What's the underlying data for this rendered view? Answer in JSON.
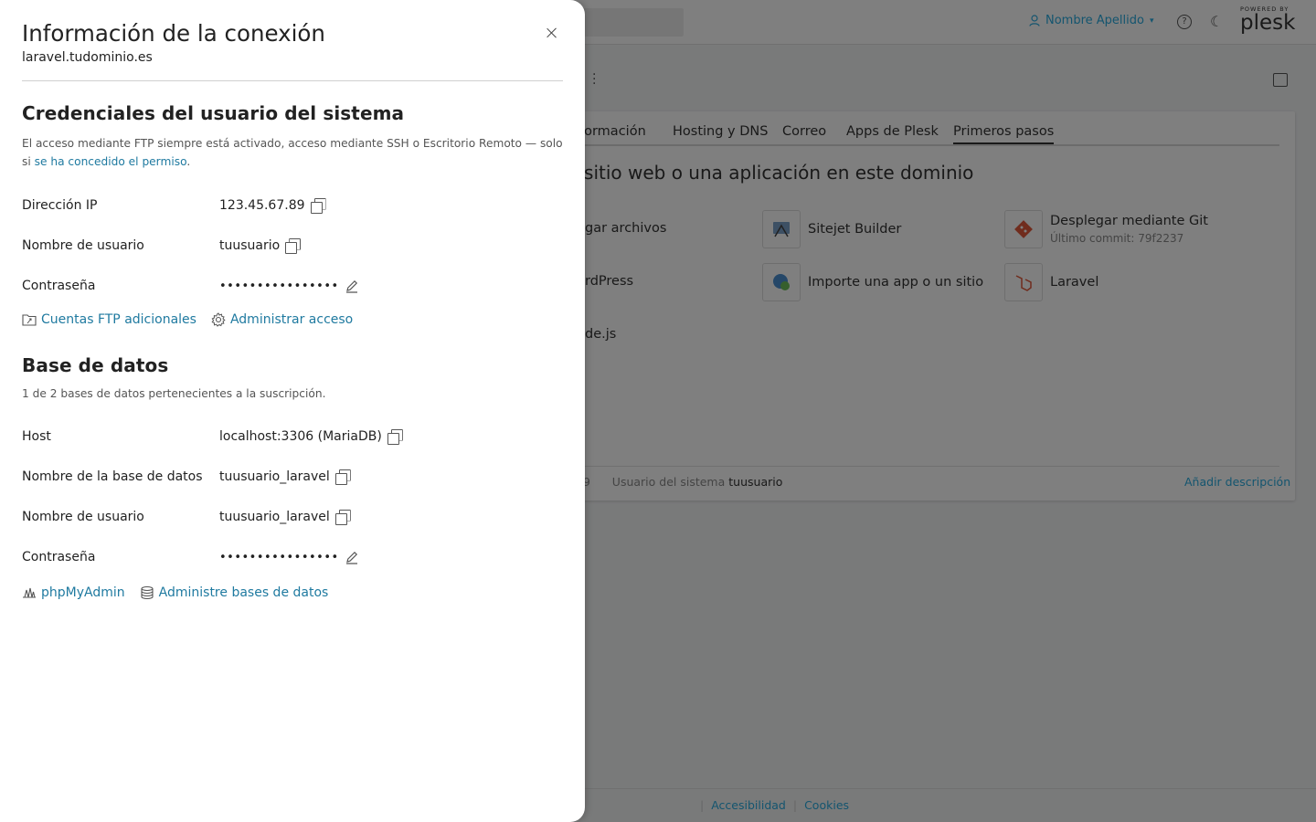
{
  "background": {
    "user_name": "Nombre Apellido",
    "logo_powered": "POWERED BY",
    "logo_name": "plesk",
    "tabs": [
      "formación",
      "Hosting y DNS",
      "Correo",
      "Apps de Plesk",
      "Primeros pasos"
    ],
    "active_tab": "Primeros pasos",
    "heading": "n sitio web o una aplicación en este dominio",
    "apps": {
      "upload": "gar archivos",
      "sitejet": "Sitejet Builder",
      "git": "Desplegar mediante Git",
      "git_sub": "Último commit: 79f2237",
      "wordpress": "rdPress",
      "import": "Importe una app o un sitio",
      "laravel": "Laravel",
      "node": "de.js"
    },
    "footer_left_num": "9",
    "system_user_label": "Usuario del sistema",
    "system_user_value": "tuusuario",
    "add_description": "Añadir descripción",
    "footer_links": [
      "Accesibilidad",
      "Cookies"
    ]
  },
  "drawer": {
    "title": "Información de la conexión",
    "subtitle": "laravel.tudominio.es",
    "system": {
      "title": "Credenciales del usuario del sistema",
      "description": "El acceso mediante FTP siempre está activado, acceso mediante SSH o Escritorio Remoto — solo si ",
      "description_link": "se ha concedido el permiso",
      "description_end": ".",
      "ip_label": "Dirección IP",
      "ip_value": "123.45.67.89",
      "user_label": "Nombre de usuario",
      "user_value": "tuusuario",
      "pwd_label": "Contraseña",
      "pwd_value": "••••••••••••••••",
      "ftp_link": "Cuentas FTP adicionales",
      "manage_link": "Administrar acceso"
    },
    "database": {
      "title": "Base de datos",
      "description": "1 de 2 bases de datos pertenecientes a la suscripción.",
      "host_label": "Host",
      "host_value": "localhost:3306 (MariaDB)",
      "dbname_label": "Nombre de la base de datos",
      "dbname_value": "tuusuario_laravel",
      "user_label": "Nombre de usuario",
      "user_value": "tuusuario_laravel",
      "pwd_label": "Contraseña",
      "pwd_value": "••••••••••••••••",
      "phpmyadmin_link": "phpMyAdmin",
      "manage_db_link": "Administre bases de datos"
    }
  }
}
